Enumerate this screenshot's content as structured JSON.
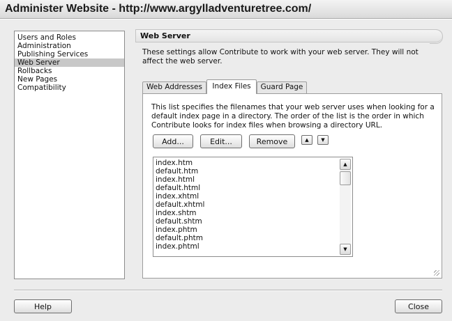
{
  "window": {
    "title": "Administer Website - http://www.argylladventuretree.com/"
  },
  "sidebar": {
    "items": [
      {
        "label": "Users and Roles"
      },
      {
        "label": "Administration"
      },
      {
        "label": "Publishing Services"
      },
      {
        "label": "Web Server",
        "selected": true
      },
      {
        "label": "Rollbacks"
      },
      {
        "label": "New Pages"
      },
      {
        "label": "Compatibility"
      }
    ]
  },
  "panel": {
    "title": "Web Server",
    "description": "These settings allow Contribute to work with your web server. They will not affect the web server."
  },
  "tabs": [
    {
      "label": "Web Addresses"
    },
    {
      "label": "Index Files",
      "active": true
    },
    {
      "label": "Guard Page"
    }
  ],
  "index_files": {
    "description": "This list specifies the filenames that your web server uses when looking for a default index page in a directory. The order of the list is the order in which Contribute looks for index files when browsing a directory URL.",
    "buttons": {
      "add": "Add...",
      "edit": "Edit...",
      "remove": "Remove"
    },
    "files": [
      "index.htm",
      "default.htm",
      "index.html",
      "default.html",
      "index.xhtml",
      "default.xhtml",
      "index.shtm",
      "default.shtm",
      "index.phtm",
      "default.phtm",
      "index.phtml"
    ]
  },
  "footer": {
    "help_label": "Help",
    "close_label": "Close"
  }
}
